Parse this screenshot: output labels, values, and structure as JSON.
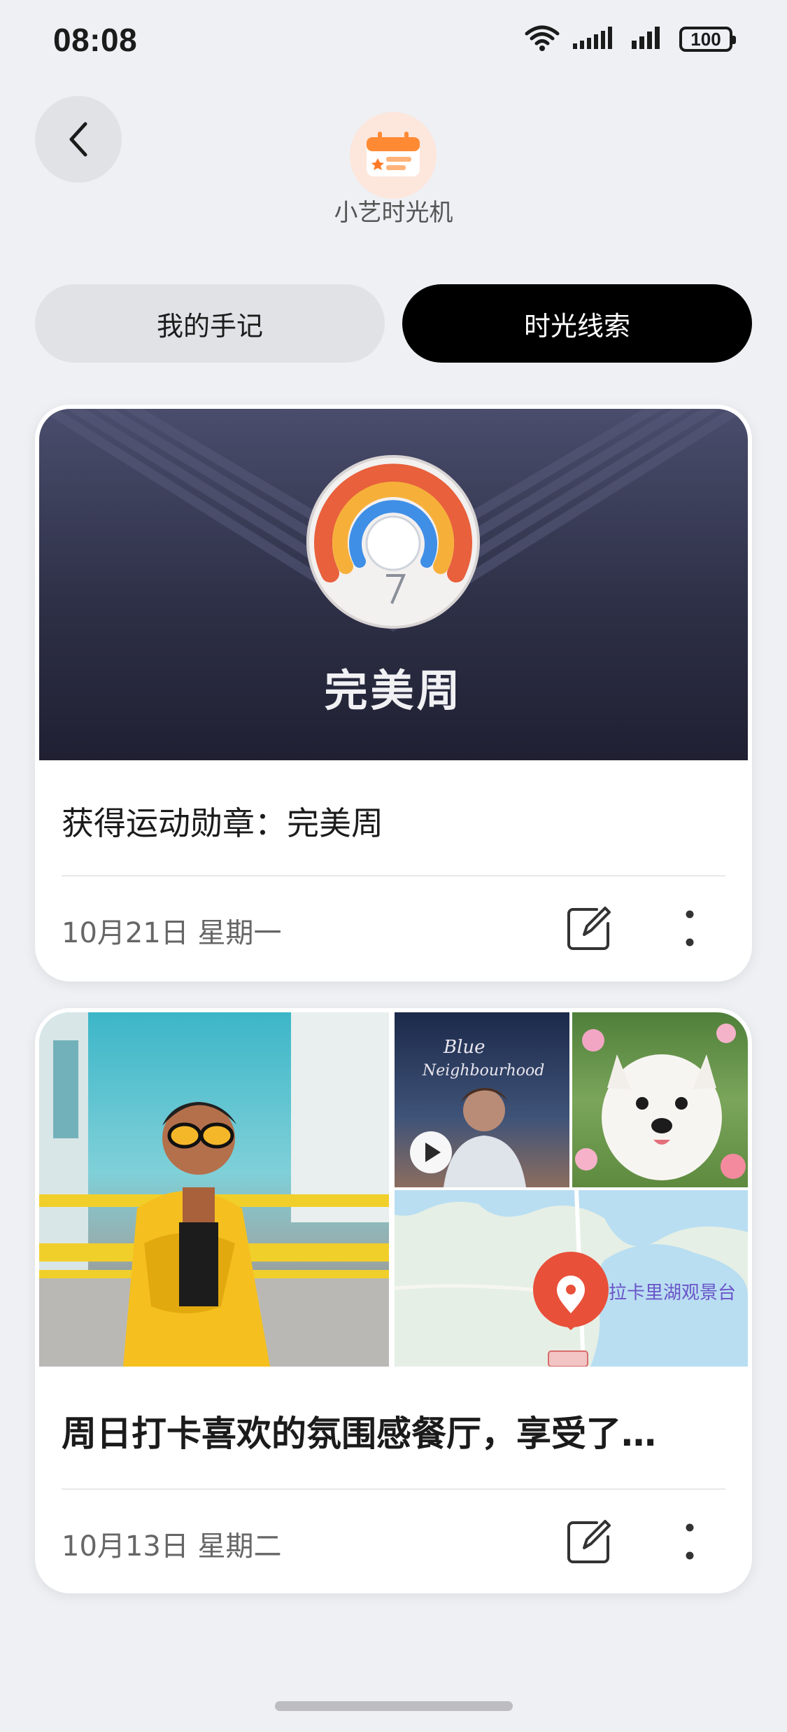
{
  "status_bar": {
    "time": "08:08",
    "battery": "100"
  },
  "header": {
    "app_name": "小艺时光机",
    "icon": "calendar-icon"
  },
  "tabs": [
    {
      "label": "我的手记",
      "selected": false
    },
    {
      "label": "时光线索",
      "selected": true
    }
  ],
  "cards": [
    {
      "banner_title": "完美周",
      "title": "获得运动勋章：完美周",
      "date": "10月21日  星期一"
    },
    {
      "title": "周日打卡喜欢的氛围感餐厅，享受了…",
      "date": "10月13日  星期二",
      "map_label": "拉卡里湖观景台"
    }
  ]
}
